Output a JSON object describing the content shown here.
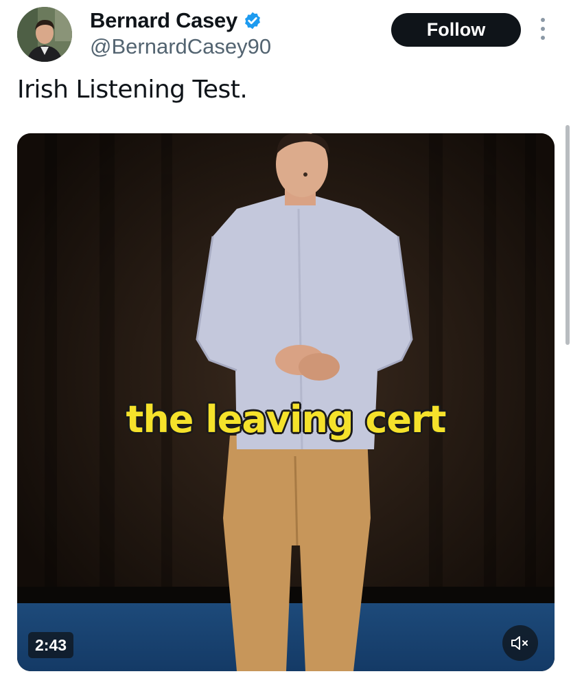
{
  "author": {
    "display_name": "Bernard Casey",
    "handle": "@BernardCasey90",
    "verified_icon": "verified-badge-icon",
    "avatar_icon": "avatar"
  },
  "actions": {
    "follow_label": "Follow",
    "more_icon": "more-options-icon"
  },
  "tweet": {
    "text": "Irish Listening Test."
  },
  "video": {
    "caption": "the leaving cert",
    "duration": "2:43",
    "mute_icon": "speaker-muted-icon"
  },
  "colors": {
    "caption_yellow": "#f5e22b",
    "follow_bg": "#0f1419",
    "verified_blue": "#1d9bf0",
    "handle_gray": "#536471"
  }
}
